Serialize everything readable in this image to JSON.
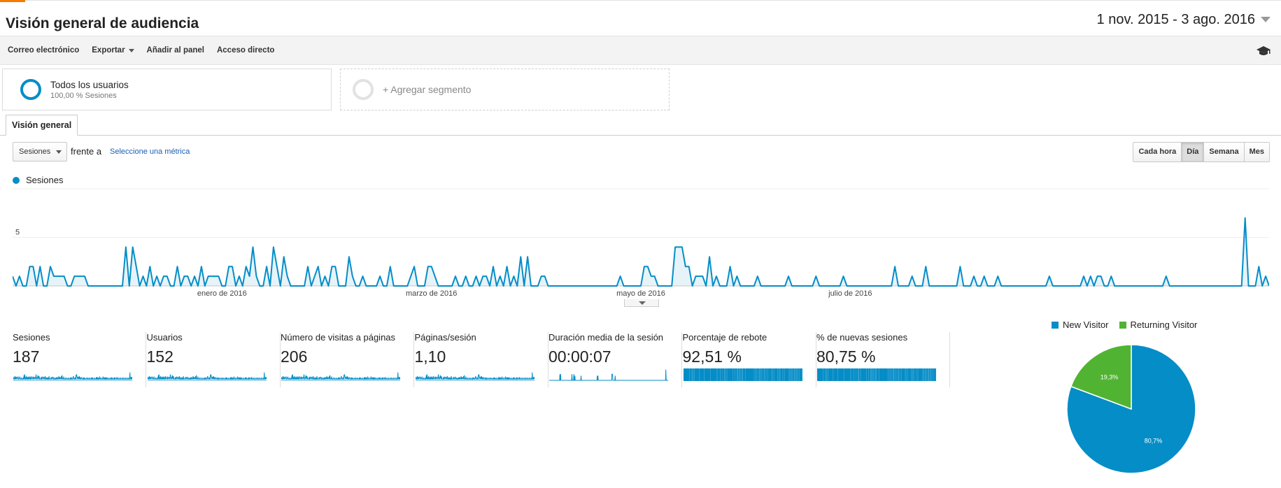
{
  "page": {
    "title": "Visión general de audiencia",
    "date_range": "1 nov. 2015 - 3 ago. 2016"
  },
  "toolbar": {
    "email": "Correo electrónico",
    "export": "Exportar",
    "add_to_dashboard": "Añadir al panel",
    "shortcut": "Acceso directo",
    "academy_icon": "graduation-cap-icon"
  },
  "segments": {
    "all_users": {
      "name": "Todos los usuarios",
      "detail": "100,00 % Sesiones"
    },
    "add": "+ Agregar segmento"
  },
  "tabs": {
    "overview": "Visión general"
  },
  "controls": {
    "metric_select": "Sesiones",
    "versus": "frente a",
    "select_metric": "Seleccione una métrica",
    "periods": [
      "Cada hora",
      "Día",
      "Semana",
      "Mes"
    ],
    "active_period": "Día"
  },
  "colors": {
    "primary": "#058dc7",
    "secondary": "#50b432",
    "accent": "#f57c00"
  },
  "chart_data": {
    "type": "area",
    "series": [
      {
        "name": "Sesiones",
        "values": [
          1,
          0,
          1,
          0,
          0,
          2,
          2,
          0,
          2,
          0,
          0,
          2,
          1,
          1,
          1,
          1,
          0,
          0,
          1,
          1,
          1,
          1,
          0,
          0,
          0,
          0,
          0,
          0,
          0,
          0,
          0,
          0,
          0,
          4,
          0,
          4,
          2,
          0,
          1,
          0,
          2,
          0,
          1,
          0,
          1,
          1,
          0,
          0,
          2,
          0,
          1,
          1,
          0,
          1,
          0,
          2,
          0,
          1,
          1,
          1,
          1,
          0,
          0,
          2,
          2,
          0,
          1,
          0,
          2,
          1,
          4,
          1,
          0,
          0,
          2,
          0,
          4,
          2,
          0,
          3,
          1,
          0,
          0,
          0,
          0,
          0,
          2,
          0,
          1,
          2,
          0,
          1,
          0,
          2,
          2,
          0,
          0,
          0,
          3,
          1,
          0,
          0,
          1,
          0,
          0,
          0,
          0,
          1,
          0,
          0,
          2,
          0,
          0,
          0,
          0,
          0,
          1,
          2,
          0,
          0,
          0,
          2,
          2,
          1,
          0,
          0,
          0,
          0,
          0,
          1,
          0,
          0,
          1,
          0,
          0,
          1,
          0,
          1,
          1,
          0,
          2,
          0,
          1,
          0,
          2,
          0,
          1,
          0,
          3,
          0,
          3,
          0,
          0,
          0,
          1,
          1,
          0,
          0,
          0,
          0,
          0,
          0,
          0,
          0,
          0,
          0,
          0,
          0,
          0,
          0,
          0,
          0,
          0,
          0,
          0,
          0,
          0,
          1,
          0,
          0,
          0,
          0,
          0,
          0,
          2,
          2,
          1,
          1,
          0,
          0,
          0,
          0,
          0,
          4,
          4,
          4,
          2,
          2,
          0,
          1,
          1,
          1,
          0,
          3,
          0,
          1,
          0,
          0,
          0,
          2,
          0,
          1,
          0,
          0,
          0,
          0,
          0,
          1,
          0,
          0,
          0,
          0,
          0,
          0,
          0,
          0,
          1,
          0,
          0,
          0,
          0,
          0,
          0,
          0,
          1,
          0,
          0,
          0,
          0,
          0,
          0,
          0,
          1,
          0,
          0,
          0,
          0,
          0,
          0,
          0,
          0,
          0,
          0,
          0,
          0,
          0,
          0,
          2,
          0,
          0,
          0,
          0,
          1,
          0,
          0,
          0,
          2,
          0,
          0,
          0,
          0,
          0,
          0,
          0,
          0,
          0,
          2,
          0,
          0,
          0,
          1,
          0,
          0,
          1,
          0,
          0,
          0,
          1,
          0,
          0,
          0,
          0,
          0,
          0,
          0,
          0,
          0,
          0,
          0,
          0,
          0,
          0,
          1,
          0,
          0,
          0,
          0,
          0,
          0,
          0,
          0,
          0,
          1,
          0,
          1,
          0,
          1,
          1,
          0,
          0,
          1,
          0,
          0,
          0,
          0,
          0,
          0,
          0,
          0,
          0,
          0,
          0,
          0,
          0,
          0,
          0,
          1,
          0,
          0,
          0,
          0,
          0,
          0,
          0,
          0,
          0,
          0,
          0,
          0,
          0,
          0,
          0,
          0,
          0,
          0,
          0,
          0,
          0,
          0,
          7,
          0,
          0,
          0,
          2,
          0,
          1,
          0
        ]
      }
    ],
    "x_labels": [
      "enero de 2016",
      "marzo de 2016",
      "mayo de 2016",
      "julio de 2016"
    ],
    "x_label_index": [
      61,
      122,
      183,
      244
    ],
    "y_ticks": [
      5,
      10
    ],
    "ylim": [
      0,
      10
    ],
    "grid": true,
    "legend_position": "top-left"
  },
  "metrics": [
    {
      "name": "Sesiones",
      "value": "187",
      "spark": "line"
    },
    {
      "name": "Usuarios",
      "value": "152",
      "spark": "line"
    },
    {
      "name": "Número de visitas a páginas",
      "value": "206",
      "spark": "line"
    },
    {
      "name": "Páginas/sesión",
      "value": "1,10",
      "spark": "line"
    },
    {
      "name": "Duración media de la sesión",
      "value": "00:00:07",
      "spark": "spikes"
    },
    {
      "name": "Porcentaje de rebote",
      "value": "92,51 %",
      "spark": "bars"
    },
    {
      "name": "% de nuevas sesiones",
      "value": "80,75 %",
      "spark": "bars"
    }
  ],
  "pie_chart": {
    "type": "pie",
    "legend": [
      "New Visitor",
      "Returning Visitor"
    ],
    "values": [
      80.7,
      19.3
    ],
    "labels": [
      "80,7%",
      "19,3%"
    ],
    "colors": [
      "#058dc7",
      "#50b432"
    ]
  }
}
